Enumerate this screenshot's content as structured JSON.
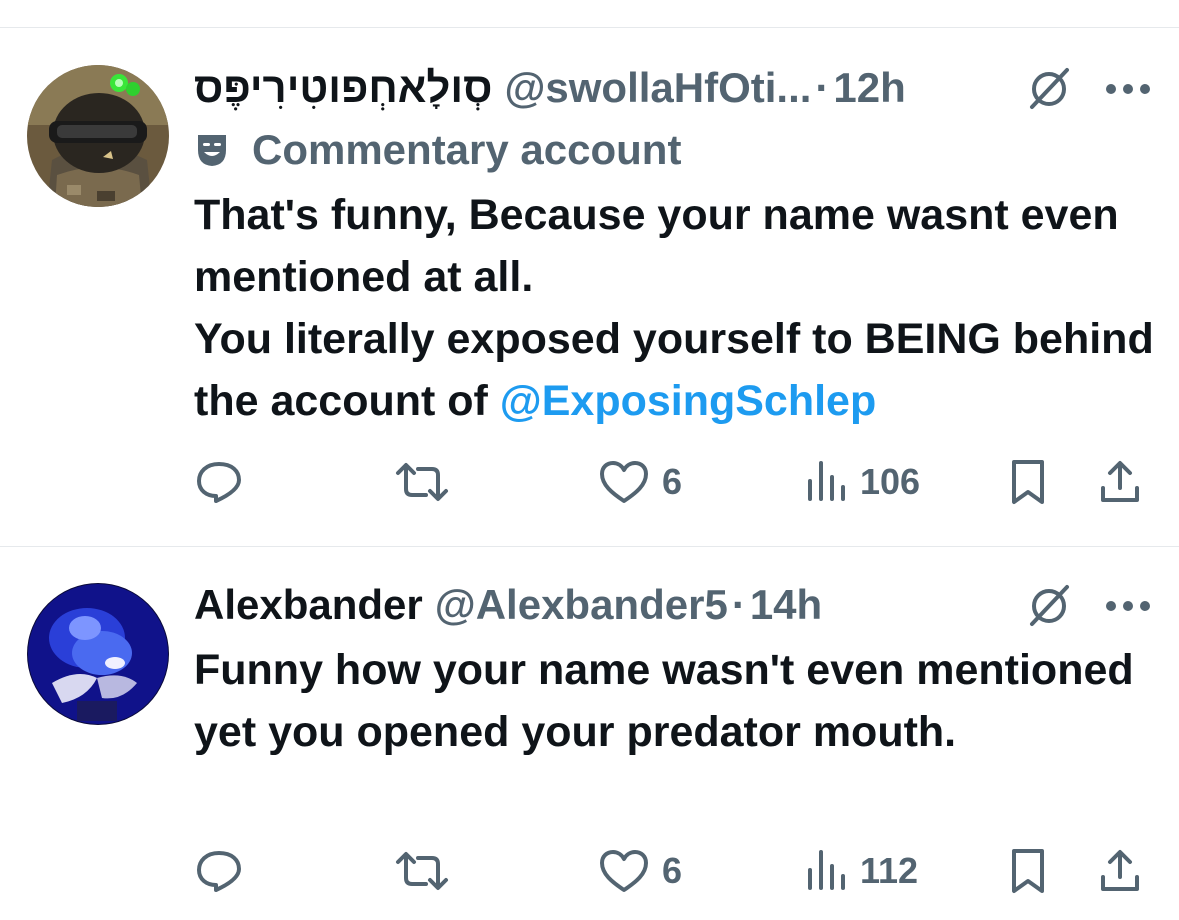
{
  "tweets": [
    {
      "author_name": "סְולָאחְפוטִירִיפֶּס",
      "author_handle": "@swollaHfOti...",
      "separator": "·",
      "time": "12h",
      "label": "Commentary account",
      "text_lines": [
        "That's funny, Because your name wasnt even mentioned at all.",
        "You literally exposed yourself to BEING behind the account of "
      ],
      "mention": "@ExposingSchlep",
      "likes": "6",
      "views": "106",
      "icons": [
        "grok-icon",
        "more-icon",
        "comedy-mask-icon",
        "reply-icon",
        "retweet-icon",
        "like-icon",
        "views-icon",
        "bookmark-icon",
        "share-icon"
      ]
    },
    {
      "author_name": "Alexbander",
      "author_handle": "@Alexbander5",
      "separator": "·",
      "time": "14h",
      "text": "Funny how your name wasn't even mentioned yet you opened your predator mouth.",
      "likes": "6",
      "views": "112",
      "icons": [
        "grok-icon",
        "more-icon",
        "reply-icon",
        "retweet-icon",
        "like-icon",
        "views-icon",
        "bookmark-icon",
        "share-icon"
      ]
    }
  ],
  "colors": {
    "text": "#0f1419",
    "secondary": "#536471",
    "link": "#1d9bf0",
    "divider": "#e6e9ec"
  }
}
